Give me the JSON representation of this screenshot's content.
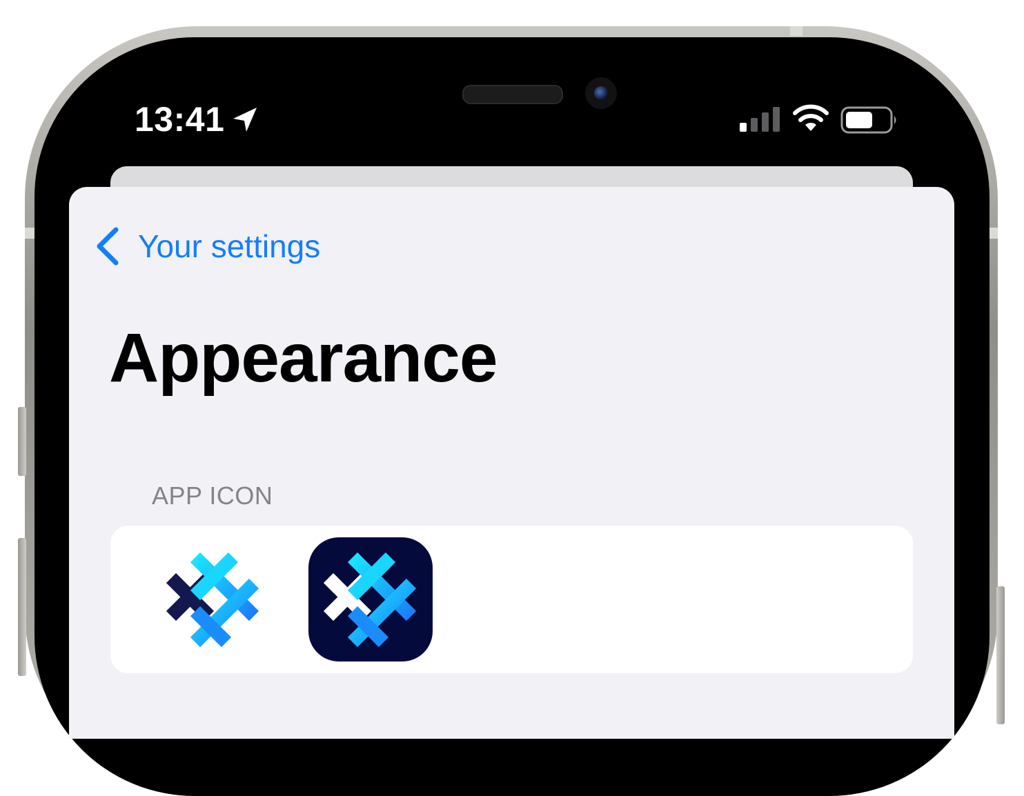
{
  "status_bar": {
    "time": "13:41",
    "location_icon": "location-arrow-icon",
    "signal_icon": "cellular-signal-icon",
    "wifi_icon": "wifi-icon",
    "battery_icon": "battery-icon"
  },
  "nav": {
    "back_icon": "chevron-left-icon",
    "back_label": "Your settings"
  },
  "page": {
    "title": "Appearance"
  },
  "sections": {
    "app_icon": {
      "header": "APP ICON",
      "options": [
        {
          "name": "default",
          "style": "light"
        },
        {
          "name": "dark",
          "style": "dark"
        }
      ]
    }
  },
  "colors": {
    "accent": "#157ef8",
    "background": "#f1f1f6",
    "dark_icon_bg": "#050a3d",
    "logo_navy": "#13194f",
    "logo_cyan": "#19d6ff",
    "logo_blue": "#1a7dfa"
  }
}
